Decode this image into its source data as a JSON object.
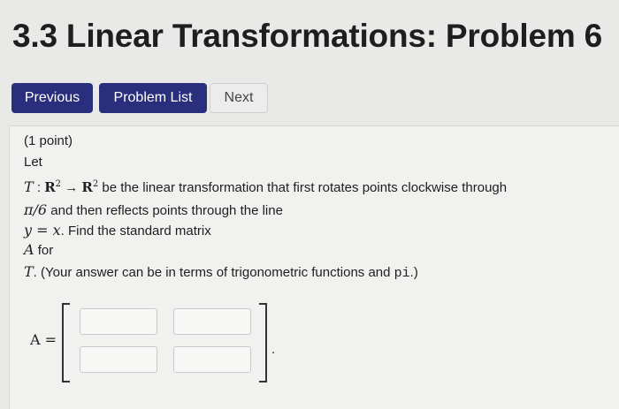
{
  "header": {
    "title": "3.3 Linear Transformations: Problem 6"
  },
  "nav": {
    "previous": "Previous",
    "problem_list": "Problem List",
    "next": "Next"
  },
  "problem": {
    "points": "(1 point)",
    "let": "Let",
    "T": "T",
    "colon": " : ",
    "R": "R",
    "exp": "2",
    "arrow": " → ",
    "line1_rest": " be the linear transformation that first rotates points clockwise through",
    "angle": "π/6",
    "line2_rest": " and then reflects points through the line",
    "line3_math": "y = x",
    "line3_rest": ". Find the standard matrix",
    "A": "A",
    "for": " for",
    "line5_rest": ". (Your answer can be in terms of trigonometric functions and ",
    "pi_code": "pi",
    "close": ".)"
  },
  "answer": {
    "label": "A =",
    "period": ".",
    "cells": [
      "",
      "",
      "",
      ""
    ]
  }
}
